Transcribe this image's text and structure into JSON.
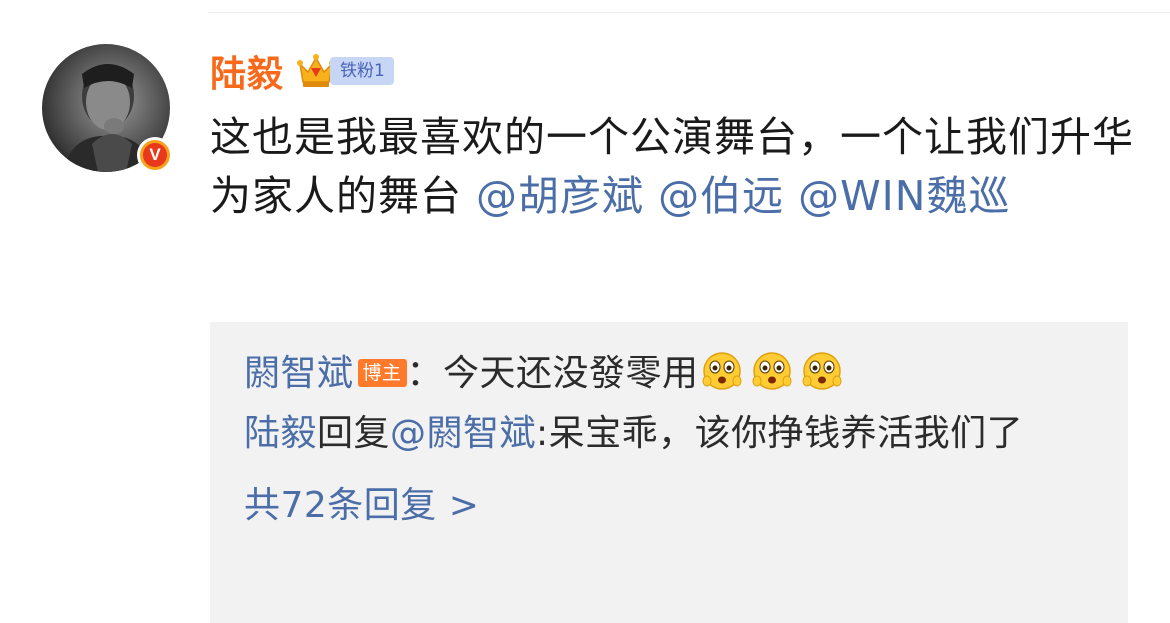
{
  "post": {
    "author": {
      "name": "陆毅",
      "verified_badge": "V",
      "fan_badge_label": "铁粉1"
    },
    "text": "这也是我最喜欢的一个公演舞台，一个让我们升华为家人的舞台",
    "mentions": [
      "@胡彦斌",
      "@伯远",
      "@WIN魏巡"
    ]
  },
  "reply_box": {
    "comment": {
      "author": "閼智斌",
      "badge": "博主",
      "separator": "：",
      "text": "今天还没發零用",
      "emoji": [
        "shocked-face",
        "shocked-face",
        "shocked-face"
      ]
    },
    "reply": {
      "author": "陆毅",
      "verb": "回复",
      "target": "@閼智斌",
      "text": ":呆宝乖，该你挣钱养活我们了"
    },
    "more_replies_label": "共72条回复 >"
  },
  "colors": {
    "username": "#f86a1a",
    "link": "#4b6ea8",
    "reply_bg": "#f2f2f2",
    "host_badge": "#ff7a2a",
    "fan_badge_bg": "#c7d6f5"
  }
}
